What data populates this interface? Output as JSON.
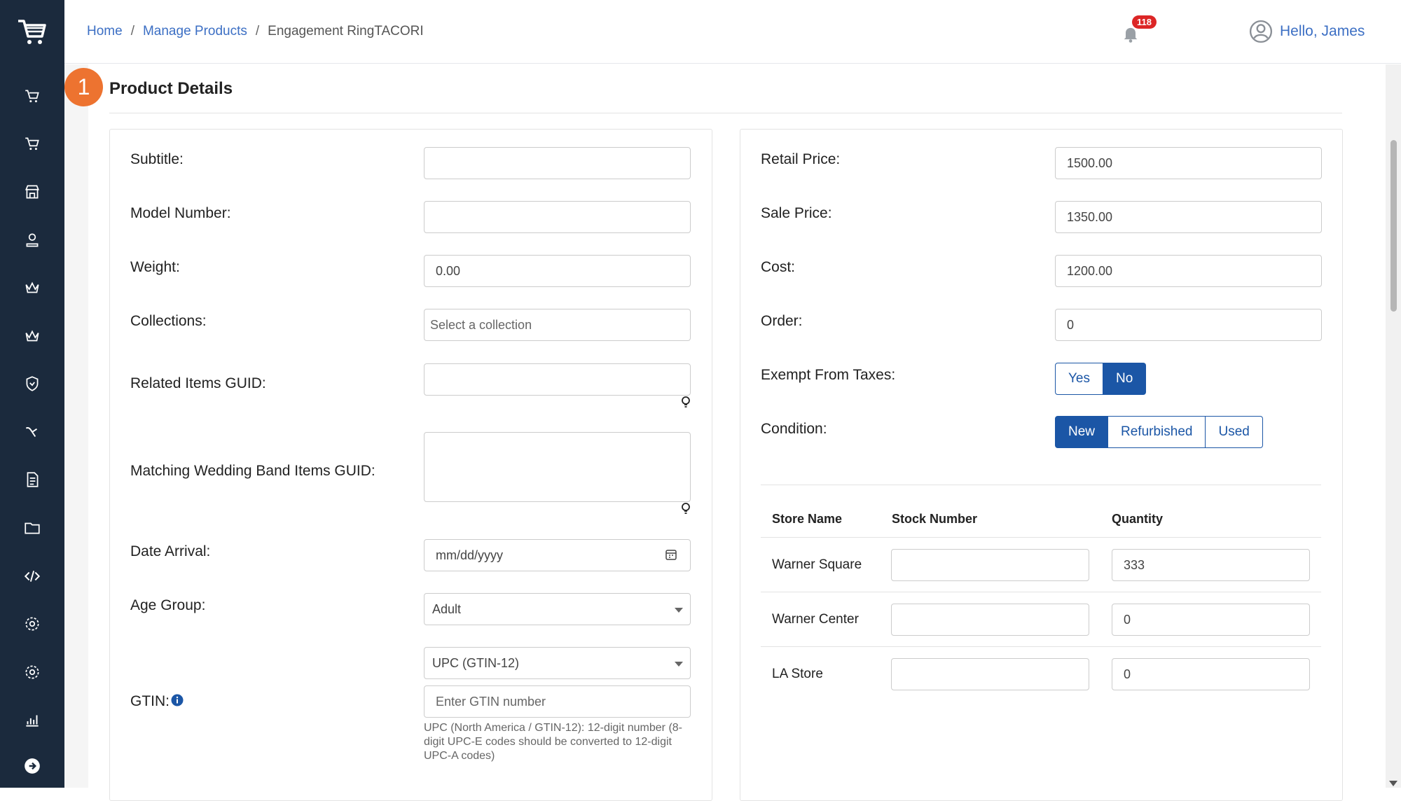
{
  "breadcrumb": {
    "home": "Home",
    "manage": "Manage Products",
    "current": "Engagement RingTACORI"
  },
  "header": {
    "notification_count": "118",
    "greeting": "Hello, James"
  },
  "section": {
    "step": "1",
    "title": "Product Details"
  },
  "left": {
    "subtitle_label": "Subtitle:",
    "subtitle_value": "",
    "model_label": "Model Number:",
    "model_value": "",
    "weight_label": "Weight:",
    "weight_value": "0.00",
    "collections_label": "Collections:",
    "collections_placeholder": "Select a collection",
    "related_label": "Related Items GUID:",
    "matching_label": "Matching Wedding Band Items GUID:",
    "date_label": "Date Arrival:",
    "date_placeholder": "mm/dd/yyyy",
    "age_label": "Age Group:",
    "age_value": "Adult",
    "gtin_label": "GTIN:",
    "gtin_type": "UPC (GTIN-12)",
    "gtin_placeholder": "Enter GTIN number",
    "gtin_help": "UPC (North America / GTIN-12): 12-digit number (8-digit UPC-E codes should be converted to 12-digit UPC-A codes)"
  },
  "right": {
    "retail_label": "Retail Price:",
    "retail_value": "1500.00",
    "sale_label": "Sale Price:",
    "sale_value": "1350.00",
    "cost_label": "Cost:",
    "cost_value": "1200.00",
    "order_label": "Order:",
    "order_value": "0",
    "exempt_label": "Exempt From Taxes:",
    "exempt_options": [
      "Yes",
      "No"
    ],
    "exempt_selected": "No",
    "condition_label": "Condition:",
    "condition_options": [
      "New",
      "Refurbished",
      "Used"
    ],
    "condition_selected": "New"
  },
  "stock_table": {
    "headers": [
      "Store Name",
      "Stock Number",
      "Quantity"
    ],
    "rows": [
      {
        "store": "Warner Square",
        "stock": "",
        "qty": "333"
      },
      {
        "store": "Warner Center",
        "stock": "",
        "qty": "0"
      },
      {
        "store": "LA Store",
        "stock": "",
        "qty": "0"
      }
    ]
  },
  "colors": {
    "sidebar": "#1b2a3d",
    "accent": "#1b56a6",
    "link": "#3c6fc4",
    "step": "#ed7330",
    "badge": "#dc2626"
  }
}
